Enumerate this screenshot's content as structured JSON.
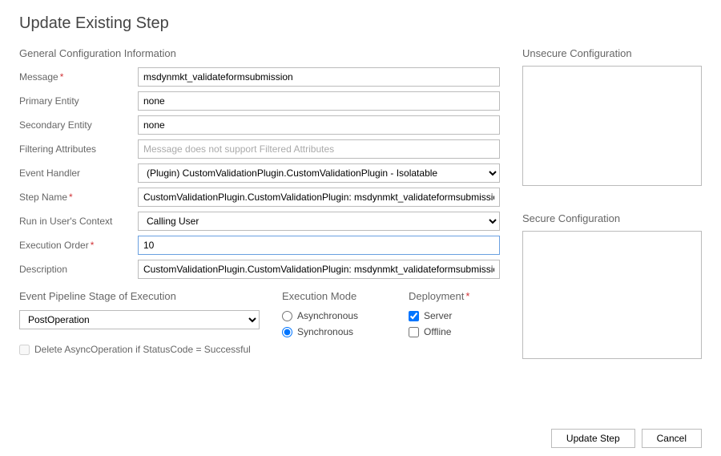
{
  "dialogTitle": "Update Existing Step",
  "generalHeading": "General Configuration Information",
  "labels": {
    "message": "Message",
    "primaryEntity": "Primary Entity",
    "secondaryEntity": "Secondary Entity",
    "filteringAttributes": "Filtering Attributes",
    "eventHandler": "Event Handler",
    "stepName": "Step Name",
    "runInUsersContext": "Run in User's Context",
    "executionOrder": "Execution Order",
    "description": "Description"
  },
  "values": {
    "message": "msdynmkt_validateformsubmission",
    "primaryEntity": "none",
    "secondaryEntity": "none",
    "filteringAttributesPlaceholder": "Message does not support Filtered Attributes",
    "eventHandler": "(Plugin) CustomValidationPlugin.CustomValidationPlugin - Isolatable",
    "stepName": "CustomValidationPlugin.CustomValidationPlugin: msdynmkt_validateformsubmission of any Ent",
    "runInUsersContext": "Calling User",
    "executionOrder": "10",
    "description": "CustomValidationPlugin.CustomValidationPlugin: msdynmkt_validateformsubmission of any Ent"
  },
  "pipeline": {
    "heading": "Event Pipeline Stage of Execution",
    "selected": "PostOperation"
  },
  "executionMode": {
    "heading": "Execution Mode",
    "asynchronous": "Asynchronous",
    "synchronous": "Synchronous",
    "selected": "synchronous"
  },
  "deployment": {
    "heading": "Deployment",
    "server": "Server",
    "offline": "Offline",
    "serverChecked": true,
    "offlineChecked": false
  },
  "deleteAsyncLabel": "Delete AsyncOperation if StatusCode = Successful",
  "deleteAsyncChecked": false,
  "unsecureHeading": "Unsecure  Configuration",
  "secureHeading": "Secure  Configuration",
  "buttons": {
    "update": "Update Step",
    "cancel": "Cancel"
  }
}
